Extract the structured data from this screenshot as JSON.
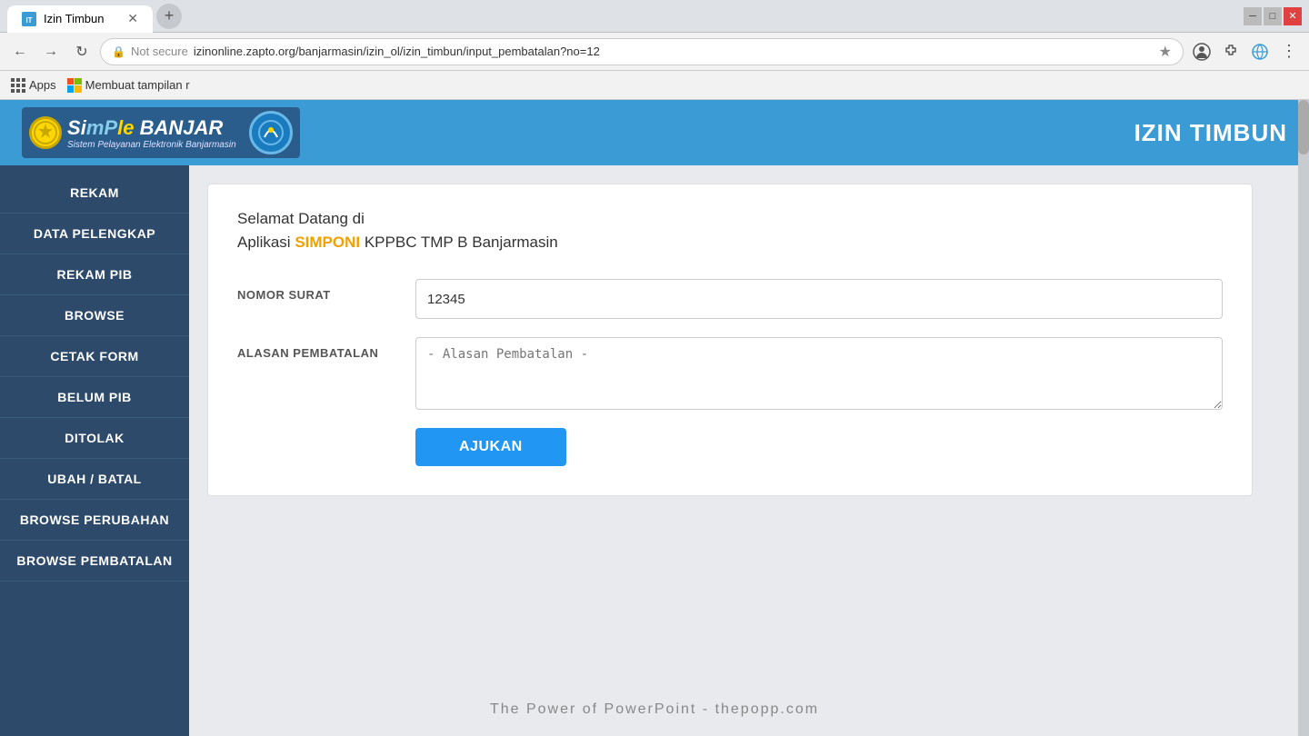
{
  "browser": {
    "tab_title": "Izin Timbun",
    "tab_favicon": "IT",
    "address": "izinonline.zapto.org/banjarmasin/izin_ol/izin_timbun/input_pembatalan?no=12",
    "new_tab_label": "+",
    "window_controls": [
      "─",
      "□",
      "✕"
    ],
    "bookmarks_apps_label": "Apps",
    "bookmarks_second_label": "Membuat tampilan r",
    "protocol": "Not secure"
  },
  "header": {
    "logo_tagline": "Sistem Pelayanan Elektronik Banjarmasin",
    "logo_main_text": "SiMPle BANJAR",
    "title": "IZIN TIMBUN"
  },
  "sidebar": {
    "items": [
      {
        "label": "REKAM"
      },
      {
        "label": "DATA PELENGKAP"
      },
      {
        "label": "REKAM PIB"
      },
      {
        "label": "BROWSE"
      },
      {
        "label": "CETAK FORM"
      },
      {
        "label": "BELUM PIB"
      },
      {
        "label": "DITOLAK"
      },
      {
        "label": "UBAH / BATAL"
      },
      {
        "label": "BROWSE PERUBAHAN"
      },
      {
        "label": "BROWSE PEMBATALAN"
      }
    ]
  },
  "form": {
    "welcome_line1": "Selamat Datang di",
    "app_label": "Aplikasi ",
    "app_name_highlight": "SIMPONI",
    "app_name_rest": " KPPBC TMP B Banjarmasin",
    "nomor_surat_label": "NOMOR SURAT",
    "nomor_surat_value": "12345",
    "alasan_label": "ALASAN PEMBATALAN",
    "alasan_placeholder": "- Alasan Pembatalan -",
    "submit_label": "AJUKAN"
  },
  "footer": {
    "watermark": "The Power of PowerPoint - thepopp.com"
  }
}
